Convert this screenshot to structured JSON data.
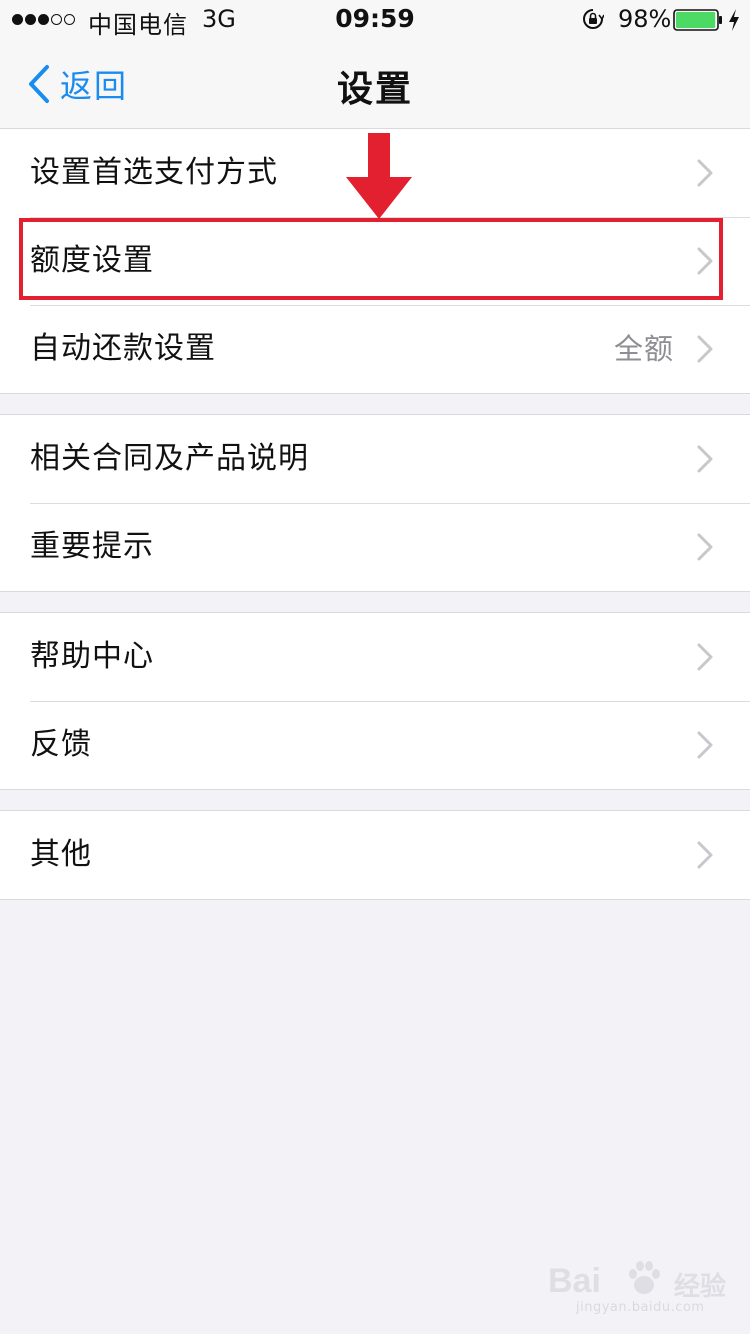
{
  "status_bar": {
    "signal_filled": 3,
    "signal_total": 5,
    "carrier": "中国电信",
    "network": "3G",
    "time": "09:59",
    "battery_percent": "98%",
    "battery_level": 0.98,
    "battery_color": "#4cd964",
    "icons": [
      "orientation-lock-icon",
      "battery-icon",
      "charging-bolt-icon"
    ]
  },
  "nav": {
    "back_label": "返回",
    "title": "设置",
    "accent_color": "#1a8cf0"
  },
  "groups": [
    {
      "rows": [
        {
          "label": "设置首选支付方式",
          "value": ""
        },
        {
          "label": "额度设置",
          "value": ""
        },
        {
          "label": "自动还款设置",
          "value": "全额"
        }
      ]
    },
    {
      "rows": [
        {
          "label": "相关合同及产品说明",
          "value": ""
        },
        {
          "label": "重要提示",
          "value": ""
        }
      ]
    },
    {
      "rows": [
        {
          "label": "帮助中心",
          "value": ""
        },
        {
          "label": "反馈",
          "value": ""
        }
      ]
    },
    {
      "rows": [
        {
          "label": "其他",
          "value": ""
        }
      ]
    }
  ],
  "annotation": {
    "highlighted_row": "额度设置",
    "highlight_color": "#e3202f"
  },
  "watermark": {
    "logo": "Bai",
    "logo_suffix": "经验",
    "url": "jingyan.baidu.com"
  }
}
